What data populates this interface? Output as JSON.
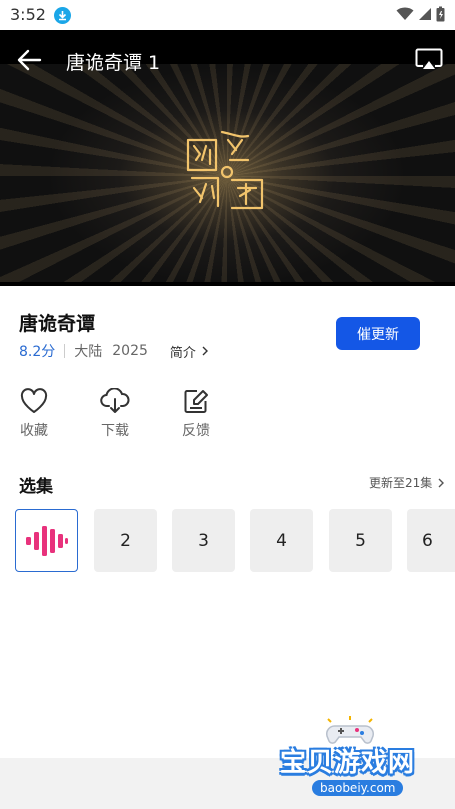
{
  "status_bar": {
    "time": "3:52"
  },
  "player": {
    "title": "唐诡奇谭 1"
  },
  "show": {
    "title": "唐诡奇谭",
    "score": "8.2分",
    "region": "大陆",
    "year": "2025",
    "intro_label": "简介",
    "update_button": "催更新"
  },
  "actions": [
    {
      "label": "收藏",
      "icon": "heart-icon"
    },
    {
      "label": "下载",
      "icon": "cloud-download-icon"
    },
    {
      "label": "反馈",
      "icon": "edit-icon"
    }
  ],
  "episodes": {
    "title": "选集",
    "more_label": "更新至21集",
    "items": [
      "2",
      "3",
      "4",
      "5",
      "6"
    ]
  },
  "watermark": {
    "cn": "宝贝游戏网",
    "en": "baobeiy.com"
  },
  "colors": {
    "accent": "#1457e6",
    "score": "#2a6bd1",
    "playing": "#e8327c"
  }
}
